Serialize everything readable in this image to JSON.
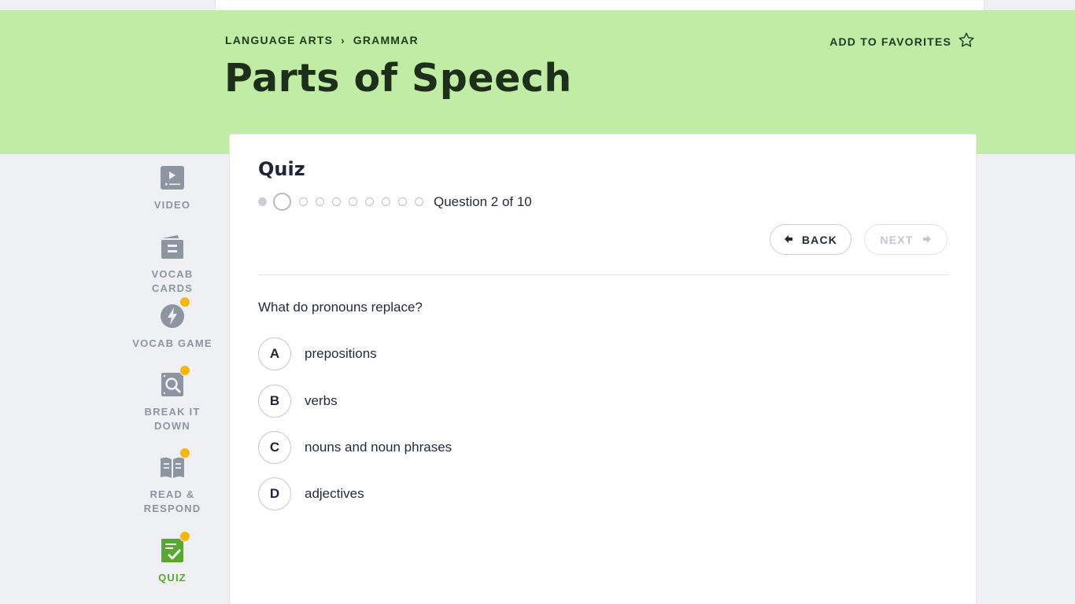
{
  "breadcrumb": {
    "subject": "LANGUAGE ARTS",
    "separator": "›",
    "topic": "GRAMMAR"
  },
  "page_title": "Parts of Speech",
  "favorites": {
    "label": "ADD TO FAVORITES",
    "icon": "star-outline-icon"
  },
  "sidebar": {
    "items": [
      {
        "label": "VIDEO",
        "icon": "video-icon",
        "badge": false,
        "active": false
      },
      {
        "label": "VOCAB CARDS",
        "icon": "vocab-cards-icon",
        "badge": false,
        "active": false
      },
      {
        "label": "VOCAB GAME",
        "icon": "lightning-icon",
        "badge": true,
        "active": false
      },
      {
        "label": "BREAK IT DOWN",
        "icon": "magnify-document-icon",
        "badge": true,
        "active": false
      },
      {
        "label": "READ & RESPOND",
        "icon": "open-book-icon",
        "badge": true,
        "active": false
      },
      {
        "label": "QUIZ",
        "icon": "checklist-icon",
        "badge": true,
        "active": true
      }
    ]
  },
  "quiz": {
    "title": "Quiz",
    "progress_text": "Question 2 of 10",
    "current_question": 2,
    "total_questions": 10,
    "back_label": "BACK",
    "next_label": "NEXT",
    "question": "What do pronouns replace?",
    "choices": [
      {
        "letter": "A",
        "text": "prepositions"
      },
      {
        "letter": "B",
        "text": "verbs"
      },
      {
        "letter": "C",
        "text": "nouns and noun phrases"
      },
      {
        "letter": "D",
        "text": "adjectives"
      }
    ]
  },
  "colors": {
    "header_bg": "#c0eca6",
    "badge": "#f8b60d",
    "active_green": "#5aa832",
    "sidebar_gray": "#8d95a3"
  }
}
